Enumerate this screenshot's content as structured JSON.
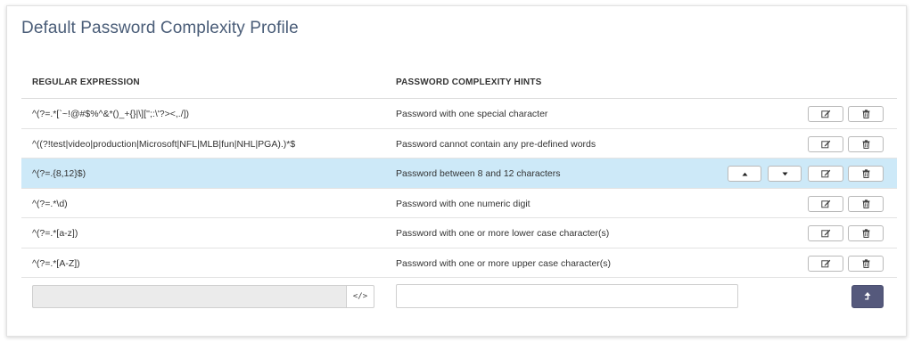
{
  "page": {
    "title": "Default Password Complexity Profile"
  },
  "table": {
    "headers": {
      "regex": "REGULAR EXPRESSION",
      "hints": "PASSWORD COMPLEXITY HINTS"
    },
    "rows": [
      {
        "regex": "^(?=.*[`~!@#$%^&*()_+{}|\\]['';:\\'?><,./])",
        "hint": "Password with one special character",
        "selected": false
      },
      {
        "regex": "^((?!test|video|production|Microsoft|NFL|MLB|fun|NHL|PGA).)*$",
        "hint": "Password cannot contain any pre-defined words",
        "selected": false
      },
      {
        "regex": "^(?=.{8,12}$)",
        "hint": "Password between 8 and 12 characters",
        "selected": true
      },
      {
        "regex": "^(?=.*\\d)",
        "hint": "Password with one numeric digit",
        "selected": false
      },
      {
        "regex": "^(?=.*[a-z])",
        "hint": "Password with one or more lower case character(s)",
        "selected": false
      },
      {
        "regex": "^(?=.*[A-Z])",
        "hint": "Password with one or more upper case character(s)",
        "selected": false
      }
    ]
  },
  "footer": {
    "regex_value": "",
    "code_button_label": "</>",
    "hint_value": ""
  },
  "colors": {
    "title": "#4a5d78",
    "selected_row": "#cde9f8",
    "submit_button": "#55597c"
  },
  "icons": {
    "edit": "pencil-square-icon",
    "delete": "trash-icon",
    "move_up": "caret-up-icon",
    "move_down": "caret-down-icon",
    "code": "code-icon",
    "submit": "upload-arrow-icon"
  }
}
